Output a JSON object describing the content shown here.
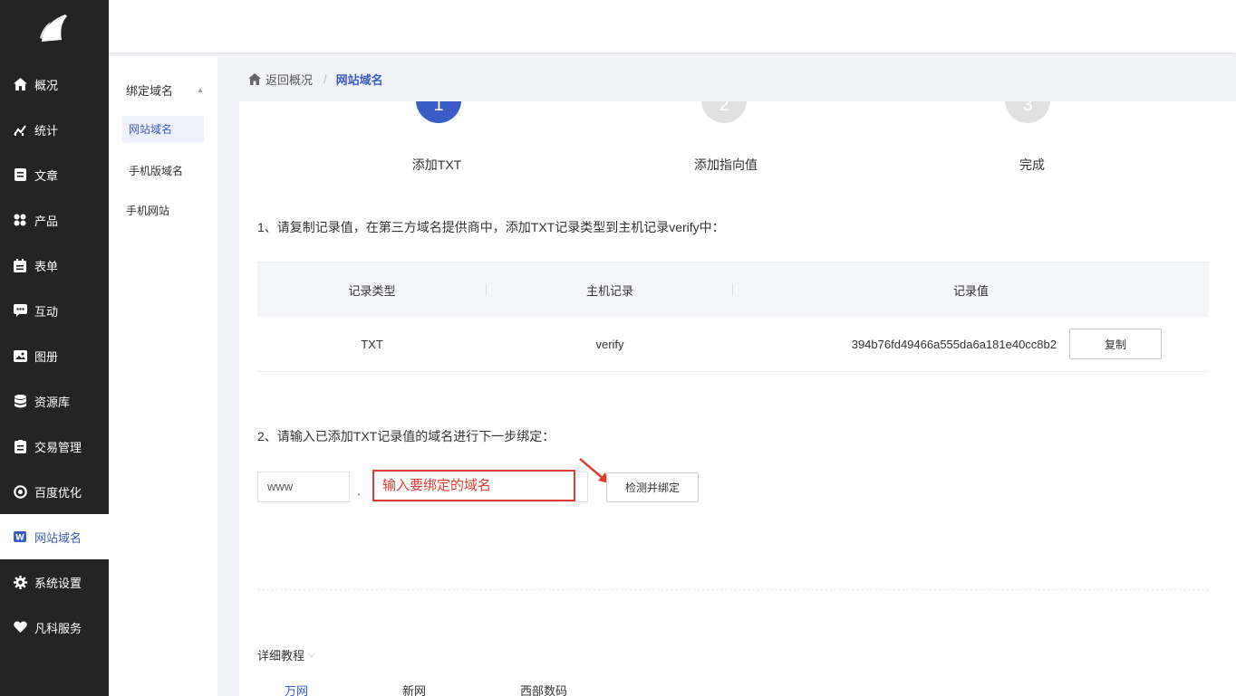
{
  "nav": {
    "items": [
      {
        "label": "概况",
        "icon": "home-icon"
      },
      {
        "label": "统计",
        "icon": "stats-icon"
      },
      {
        "label": "文章",
        "icon": "article-icon"
      },
      {
        "label": "产品",
        "icon": "product-icon"
      },
      {
        "label": "表单",
        "icon": "form-icon"
      },
      {
        "label": "互动",
        "icon": "chat-icon"
      },
      {
        "label": "图册",
        "icon": "album-icon"
      },
      {
        "label": "资源库",
        "icon": "database-icon"
      },
      {
        "label": "交易管理",
        "icon": "trade-icon"
      },
      {
        "label": "百度优化",
        "icon": "seo-icon"
      },
      {
        "label": "网站域名",
        "icon": "w-icon",
        "active": true
      },
      {
        "label": "系统设置",
        "icon": "gear-icon"
      },
      {
        "label": "凡科服务",
        "icon": "heart-icon"
      }
    ]
  },
  "subnav": {
    "group": "绑定域名",
    "items": [
      "网站域名",
      "手机版域名",
      "手机网站"
    ]
  },
  "breadcrumb": {
    "back": "返回概况",
    "separator": "/",
    "current": "网站域名"
  },
  "steps": [
    {
      "number": "1",
      "label": "添加TXT"
    },
    {
      "number": "2",
      "label": "添加指向值"
    },
    {
      "number": "3",
      "label": "完成"
    }
  ],
  "instructions": {
    "step1": "1、请复制记录值，在第三方域名提供商中，添加TXT记录类型到主机记录verify中：",
    "step2": "2、请输入已添加TXT记录值的域名进行下一步绑定："
  },
  "record_table": {
    "headers": [
      "记录类型",
      "主机记录",
      "记录值"
    ],
    "row": {
      "type": "TXT",
      "host": "verify",
      "value": "394b76fd49466a555da6a181e40cc8b2"
    },
    "copy_button": "复制"
  },
  "bind_form": {
    "prefix_value": "www",
    "dot": ".",
    "domain_placeholder": "输入要绑定的域名",
    "submit_button": "检测并绑定"
  },
  "tutorial": {
    "label": "详细教程",
    "tabs": [
      "万网",
      "新网",
      "西部数码"
    ],
    "active_tab": "万网"
  },
  "colors": {
    "accent": "#3a5cc6",
    "sidebar_bg": "#242424",
    "annotation_red": "#e03c31"
  }
}
